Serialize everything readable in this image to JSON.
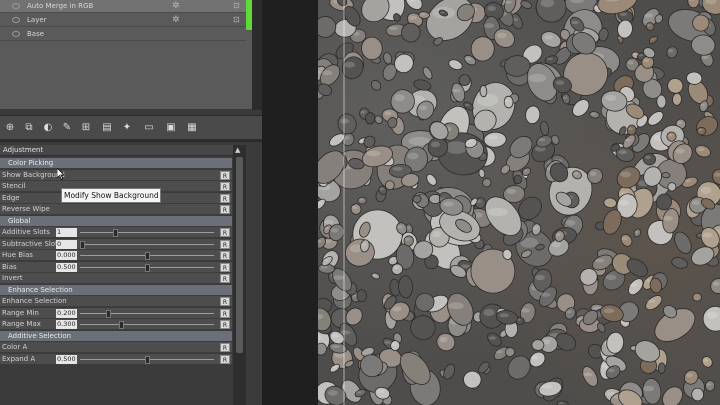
{
  "layers": {
    "rows": [
      {
        "label": "Auto Merge in RGB",
        "selected": true
      },
      {
        "label": "Layer",
        "selected": false
      },
      {
        "label": "Base",
        "selected": false
      }
    ],
    "active_color": "#5fd83a"
  },
  "toolbar": {
    "icons": [
      "add-layer-icon",
      "duplicate-layer-icon",
      "mask-icon",
      "paint-icon",
      "merge-icon",
      "group-icon",
      "brush-icon",
      "folder-icon",
      "adjust-layer-icon",
      "grid-icon"
    ]
  },
  "adjustment": {
    "title": "Adjustment",
    "rows": [
      {
        "label": "Color Picking",
        "group": true
      },
      {
        "label": "Show Background",
        "reset": "R"
      },
      {
        "label": "Stencil",
        "reset": "R"
      },
      {
        "label": "Edge",
        "reset": "R"
      },
      {
        "label": "Reverse Wipe",
        "reset": "R"
      },
      {
        "label": "Global",
        "group": true
      },
      {
        "label": "Additive Slots",
        "value": "1",
        "slider": 0.25,
        "reset": "R"
      },
      {
        "label": "Subtractive Slots",
        "value": "0",
        "slider": 0.0,
        "reset": "R"
      },
      {
        "label": "Hue Bias",
        "value": "0.000",
        "slider": 0.5,
        "reset": "R"
      },
      {
        "label": "Bias",
        "value": "0.500",
        "slider": 0.5,
        "reset": "R"
      },
      {
        "label": "Invert",
        "reset": "R"
      },
      {
        "label": "Enhance Selection",
        "group": true
      },
      {
        "label": "Enhance Selection",
        "reset": "R"
      },
      {
        "label": "Range Min",
        "value": "0.200",
        "slider": 0.2,
        "reset": "R"
      },
      {
        "label": "Range Max",
        "value": "0.300",
        "slider": 0.3,
        "reset": "R"
      },
      {
        "label": "Additive Selection",
        "group": true
      },
      {
        "label": "Color A",
        "reset": "R"
      },
      {
        "label": "Expand A",
        "value": "0.500",
        "slider": 0.5,
        "reset": "R"
      }
    ]
  },
  "tooltip": {
    "text": "Modify Show Background"
  }
}
